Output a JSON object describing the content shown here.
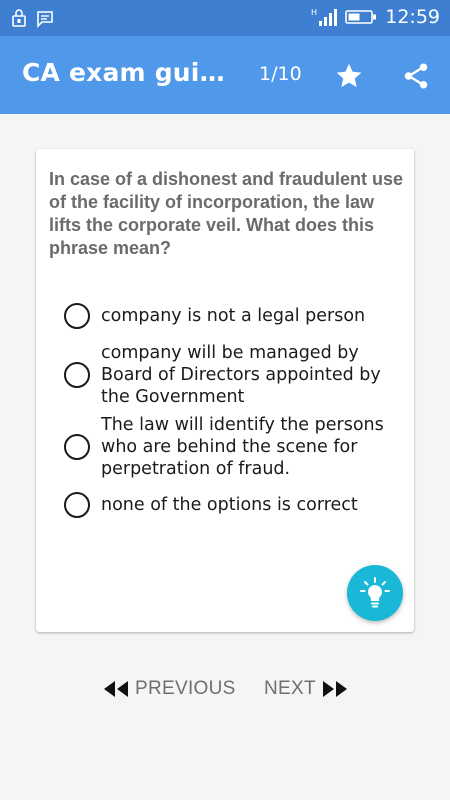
{
  "status_bar": {
    "time": "12:59",
    "icons": [
      "lock-notification-icon",
      "message-notification-icon",
      "signal-icon",
      "battery-icon"
    ]
  },
  "app_bar": {
    "title": "CA exam guide...",
    "page_indicator": "1/10",
    "actions": [
      "star-icon",
      "share-icon"
    ]
  },
  "quiz": {
    "question": "In case of a dishonest and fraudulent use of the facility of incorporation, the law lifts the corporate veil. What does this phrase mean?",
    "options": [
      "company is not a legal person",
      "company will be managed by Board of Directors appointed by the Government",
      "The law will identify the persons who are behind the scene for perpetration of fraud.",
      "none of the options is correct"
    ],
    "hint_icon": "lightbulb-icon"
  },
  "navigation": {
    "previous_label": "PREVIOUS",
    "next_label": "NEXT"
  },
  "colors": {
    "status_bar": "#3f7fd2",
    "app_bar": "#4f98ea",
    "fab": "#1ab8d6",
    "question_text": "#6b6b6b"
  }
}
